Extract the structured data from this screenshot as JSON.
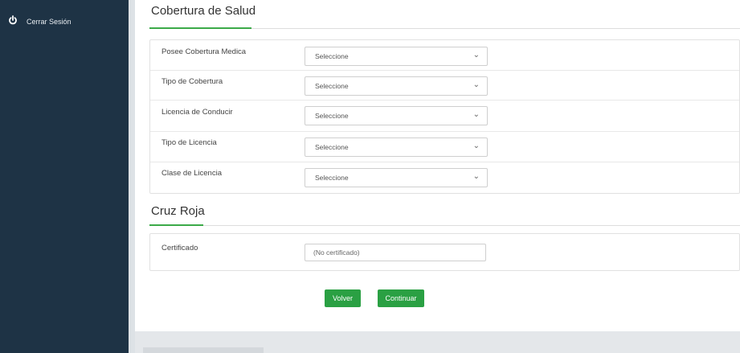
{
  "sidebar": {
    "logout_label": "Cerrar Sesión"
  },
  "health": {
    "title": "Cobertura de Salud",
    "rows": [
      {
        "label": "Posee Cobertura Medica",
        "value": "Seleccione"
      },
      {
        "label": "Tipo de Cobertura",
        "value": "Seleccione"
      },
      {
        "label": "Licencia de Conducir",
        "value": "Seleccione"
      },
      {
        "label": "Tipo de Licencia",
        "value": "Seleccione"
      },
      {
        "label": "Clase de Licencia",
        "value": "Seleccione"
      }
    ]
  },
  "red_cross": {
    "title": "Cruz Roja",
    "certificate_label": "Certificado",
    "certificate_value": "(No certificado)"
  },
  "actions": {
    "back_label": "Volver",
    "continue_label": "Continuar"
  },
  "colors": {
    "sidebar_bg": "#1e3345",
    "accent": "#3caa49",
    "button": "#2aa043"
  }
}
